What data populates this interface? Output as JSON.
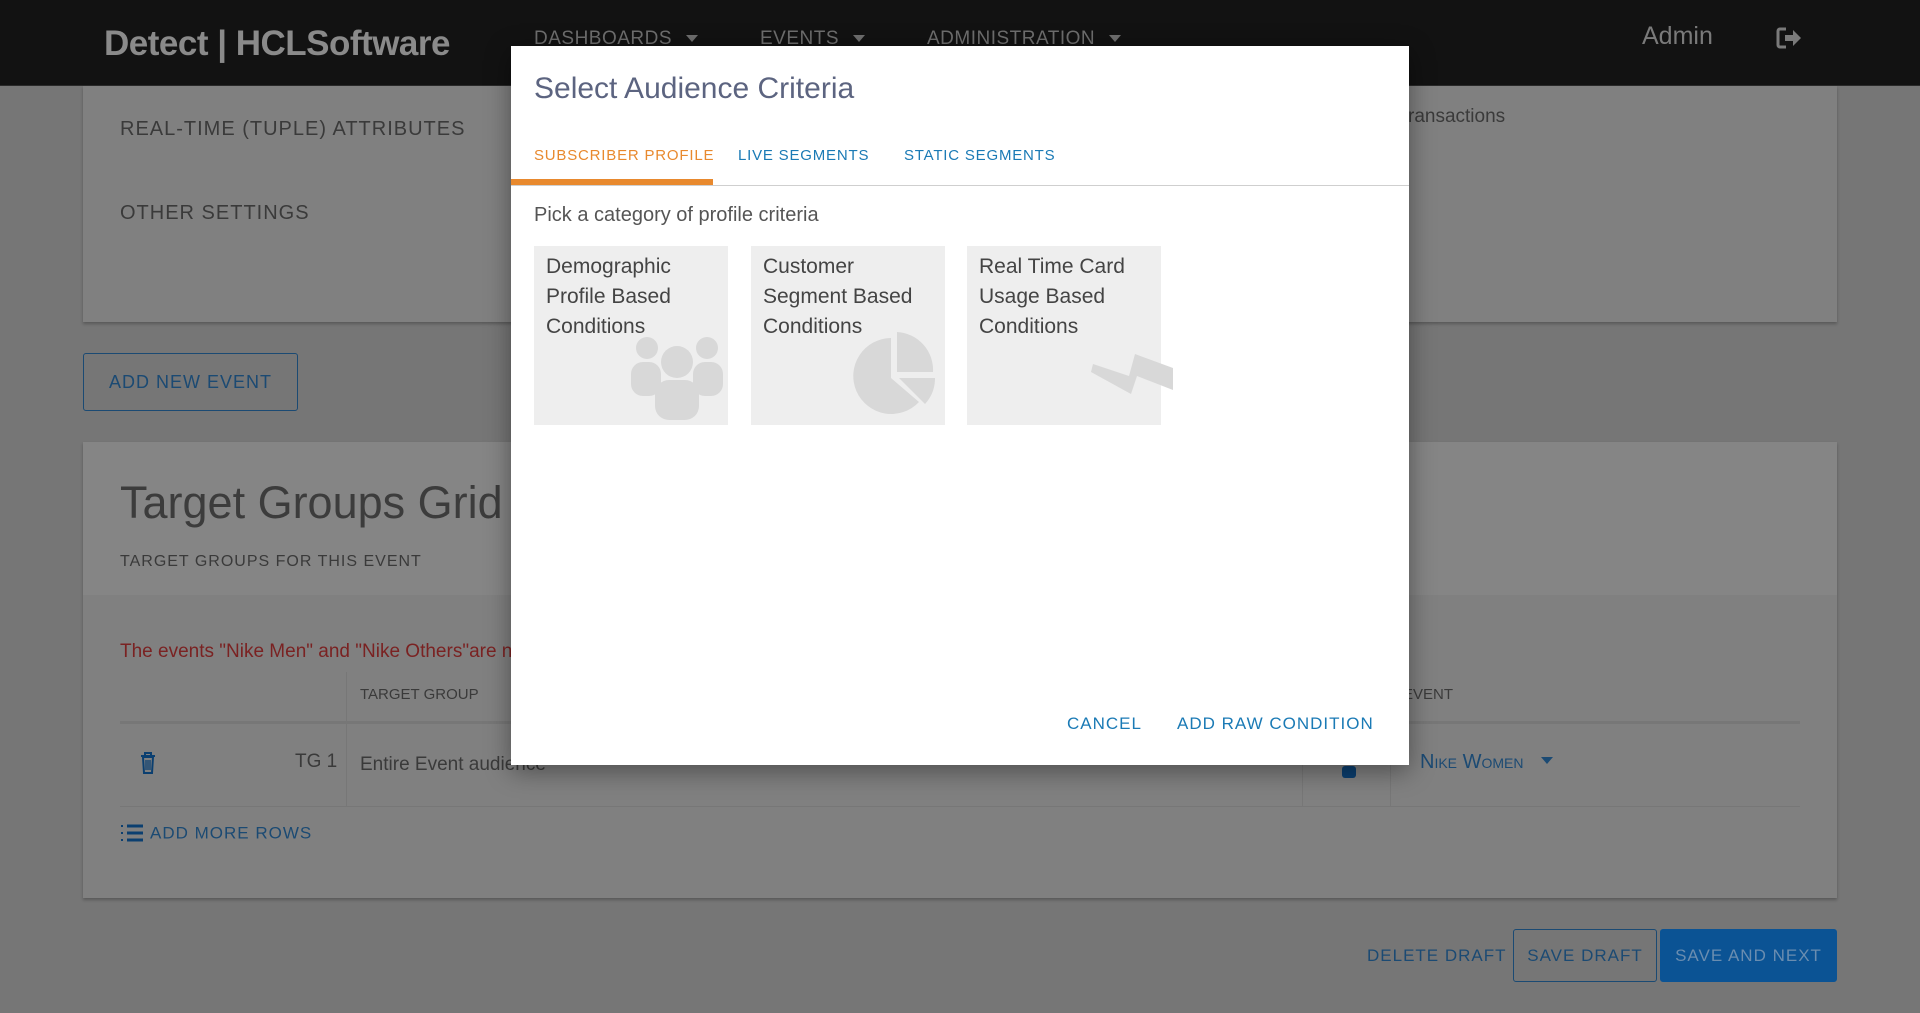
{
  "header": {
    "logo": "Detect | HCLSoftware",
    "nav": [
      "DASHBOARDS",
      "EVENTS",
      "ADMINISTRATION"
    ],
    "user": "Admin",
    "logout_icon": "sign-out-icon"
  },
  "background": {
    "section_realtime": "REAL-TIME (TUPLE) ATTRIBUTES",
    "section_other": "OTHER SETTINGS",
    "transactions_fragment": "ransactions",
    "add_new_event": "ADD NEW EVENT",
    "grid_title": "Target Groups Grid",
    "grid_subtitle": "TARGET GROUPS FOR THIS EVENT",
    "error_text": "The events \"Nike Men\" and \"Nike Others\"are no",
    "col_target_group": "TARGET GROUP",
    "col_event": "EVENT",
    "row": {
      "id": "TG 1",
      "audience": "Entire Event audience",
      "event": "Nike Women"
    },
    "add_more_rows": "ADD MORE ROWS",
    "delete_draft": "DELETE DRAFT",
    "save_draft": "SAVE DRAFT",
    "save_and_next": "SAVE AND NEXT"
  },
  "modal": {
    "title": "Select Audience Criteria",
    "tabs": [
      {
        "label": "SUBSCRIBER PROFILE",
        "active": true
      },
      {
        "label": "LIVE SEGMENTS",
        "active": false
      },
      {
        "label": "STATIC SEGMENTS",
        "active": false
      }
    ],
    "prompt": "Pick a category of profile criteria",
    "tiles": [
      {
        "label": "Demographic Profile Based Conditions",
        "icon": "users-icon"
      },
      {
        "label": "Customer Segment Based Conditions",
        "icon": "pie-chart-icon"
      },
      {
        "label": "Real Time Card Usage Based Conditions",
        "icon": "lightning-icon"
      }
    ],
    "cancel": "CANCEL",
    "add_raw_condition": "ADD RAW CONDITION"
  },
  "colors": {
    "accent_orange": "#e8892e",
    "link_blue": "#1a7ab5",
    "title": "#5c6480"
  }
}
